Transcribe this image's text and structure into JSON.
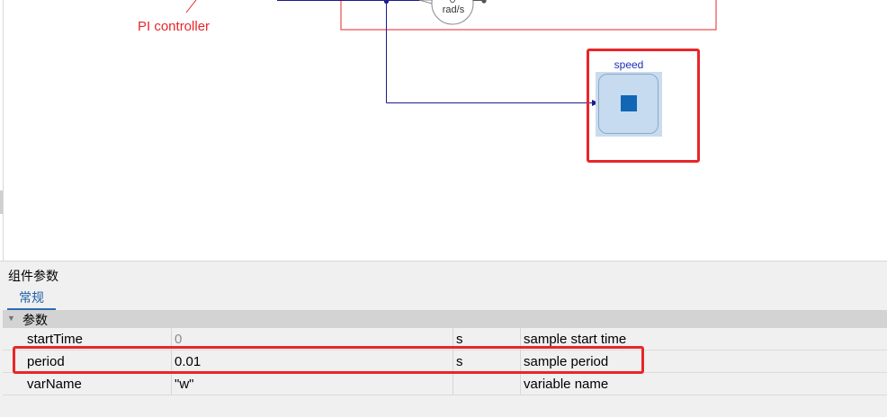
{
  "diagram": {
    "pi_label": "PI controller",
    "sensor_unit": "rad/s",
    "speed_block_label": "speed",
    "annotation_color": "#e8262a",
    "wire_color": "#1c1c8c"
  },
  "panel": {
    "title": "组件参数",
    "tab_general": "常规",
    "group_label": "参数",
    "group_toggle_icon": "triangle-down-icon",
    "rows": [
      {
        "name": "startTime",
        "value": "0",
        "unit": "s",
        "desc": "sample start time"
      },
      {
        "name": "period",
        "value": "0.01",
        "unit": "s",
        "desc": "sample period"
      },
      {
        "name": "varName",
        "value": "\"w\"",
        "unit": "",
        "desc": "variable name"
      }
    ]
  }
}
